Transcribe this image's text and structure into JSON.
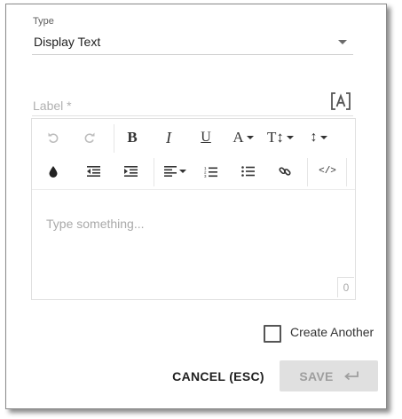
{
  "type_field": {
    "label": "Type",
    "value": "Display Text"
  },
  "label_field": {
    "placeholder": "Label *"
  },
  "toolbar": {
    "undo": "undo-icon",
    "redo": "redo-icon",
    "bold": "B",
    "italic": "I",
    "underline": "U",
    "font_color": "A",
    "font_size": "T↕",
    "line_height": "↕",
    "code_view": "</>"
  },
  "editor": {
    "placeholder": "Type something...",
    "char_count": "0"
  },
  "create_another": {
    "label": "Create Another"
  },
  "buttons": {
    "cancel": "CANCEL (ESC)",
    "save": "SAVE"
  },
  "colors": {
    "text": "#212121",
    "muted": "#a9a9a9",
    "disabled_bg": "#e0e0e0"
  }
}
